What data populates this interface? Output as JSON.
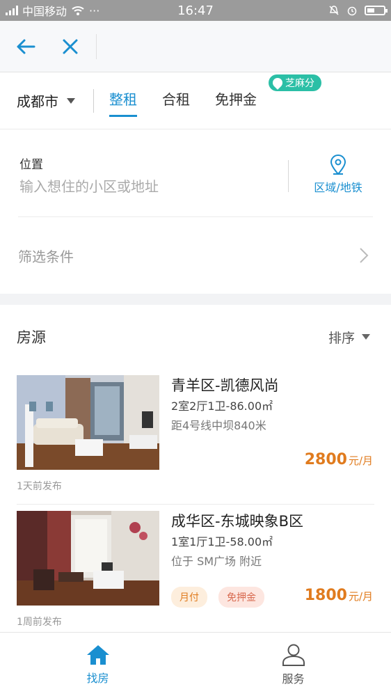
{
  "status_bar": {
    "carrier": "中国移动",
    "dots": "···",
    "time": "16:47"
  },
  "nav": {
    "back_icon": "arrow-left-icon",
    "close_icon": "close-icon",
    "accent_color": "#1a8fd0"
  },
  "filter_bar": {
    "city": "成都市",
    "tabs": [
      {
        "label": "整租",
        "active": true
      },
      {
        "label": "合租",
        "active": false
      },
      {
        "label": "免押金",
        "active": false
      }
    ],
    "zhima_badge": "芝麻分"
  },
  "location": {
    "label": "位置",
    "placeholder": "输入想住的小区或地址",
    "area_button": "区域/地铁"
  },
  "filters": {
    "label": "筛选条件"
  },
  "listings": {
    "title": "房源",
    "sort_label": "排序",
    "items": [
      {
        "title": "青羊区-凯德风尚",
        "spec": "2室2厅1卫-86.00㎡",
        "location": "距4号线中坝840米",
        "price": "2800",
        "unit": "元/月",
        "posted": "1天前发布",
        "tags": []
      },
      {
        "title": "成华区-东城映象B区",
        "spec": "1室1厅1卫-58.00㎡",
        "location": "位于 SM广场 附近",
        "price": "1800",
        "unit": "元/月",
        "posted": "1周前发布",
        "tags": [
          "月付",
          "免押金"
        ]
      }
    ],
    "price_color": "#e07b1e"
  },
  "tabbar": {
    "items": [
      {
        "label": "找房",
        "icon": "home-icon",
        "active": true
      },
      {
        "label": "服务",
        "icon": "user-icon",
        "active": false
      }
    ]
  }
}
